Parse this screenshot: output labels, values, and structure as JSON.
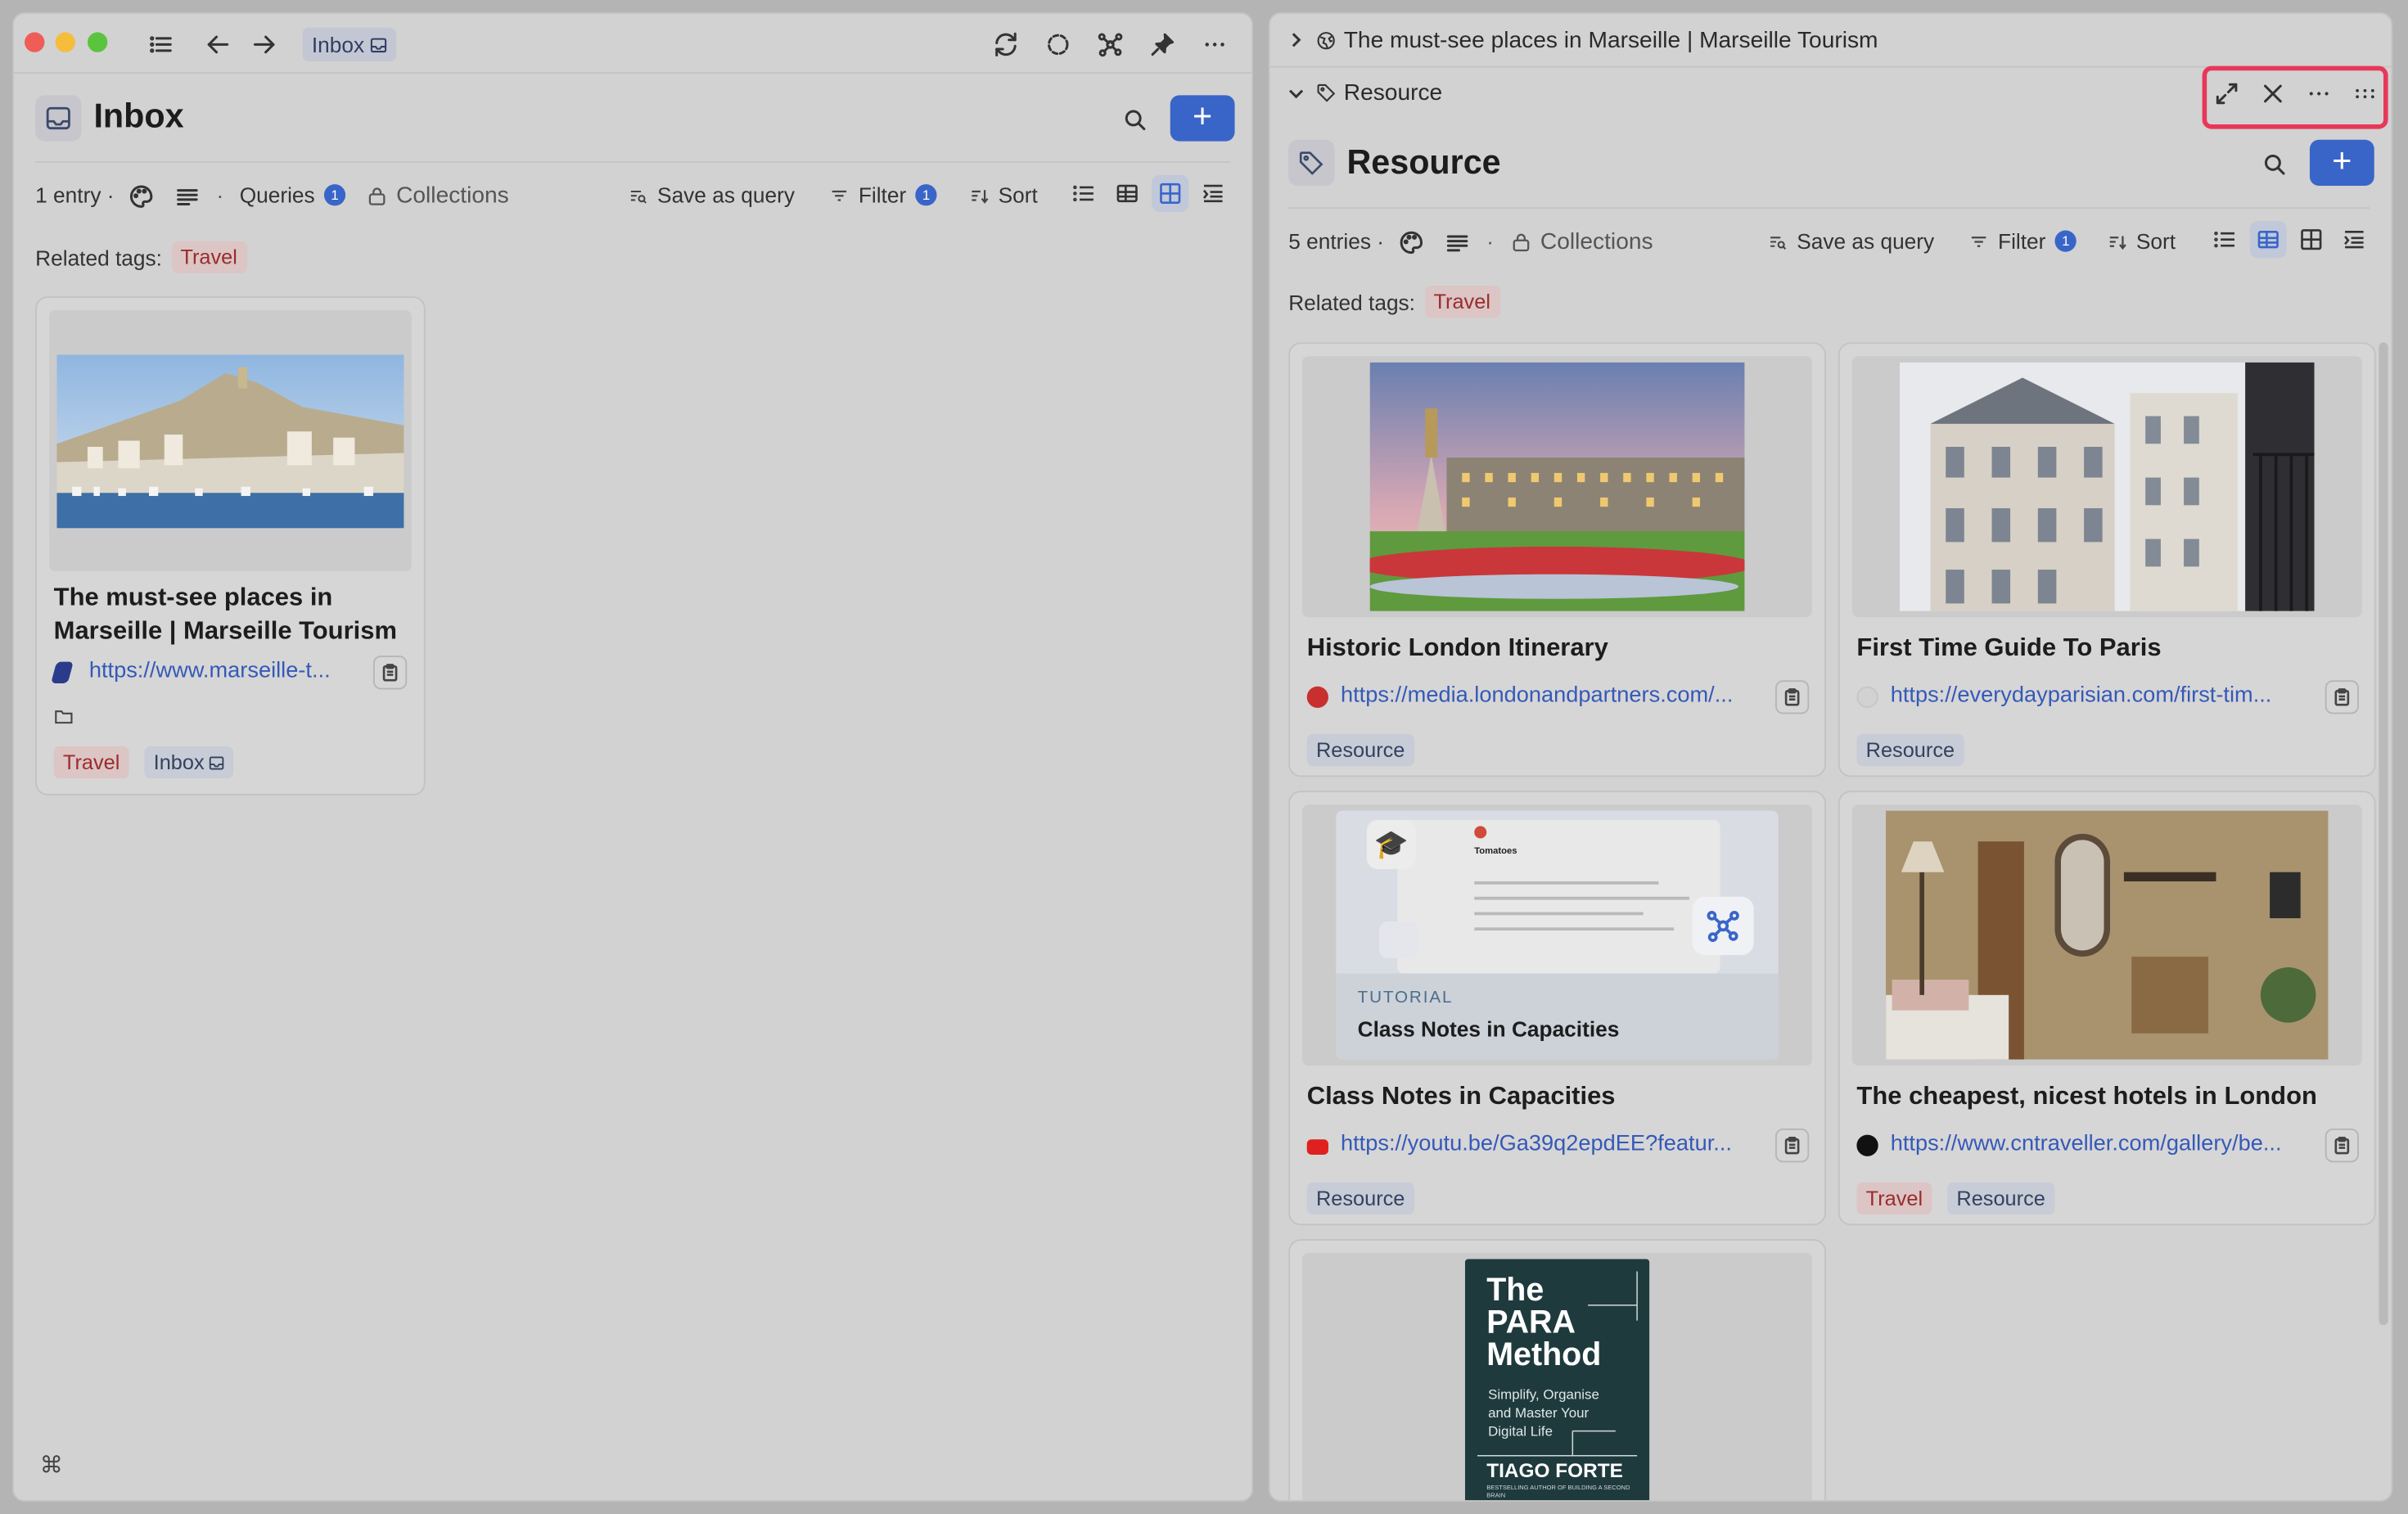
{
  "left": {
    "nav": {
      "breadcrumb_chip": "Inbox"
    },
    "page": {
      "title": "Inbox"
    },
    "toolbar": {
      "entry_count": "1 entry ·",
      "dot": "·",
      "queries_label": "Queries",
      "queries_count": "1",
      "collections_label": "Collections",
      "save_query_label": "Save as query",
      "filter_label": "Filter",
      "filter_count": "1",
      "sort_label": "Sort"
    },
    "related_tags_label": "Related tags:",
    "related_tags": [
      "Travel"
    ],
    "cards": [
      {
        "title": "The must-see places in Marseille | Marseille Tourism",
        "url": "https://www.marseille-t...",
        "tags": [
          "Travel",
          "Inbox"
        ]
      }
    ],
    "footer_shortcut": "⌘"
  },
  "right": {
    "breadcrumb_parent": "The must-see places in Marseille | Marseille Tourism",
    "breadcrumb_current": "Resource",
    "page": {
      "title": "Resource"
    },
    "toolbar": {
      "entry_count": "5 entries ·",
      "dot": "·",
      "collections_label": "Collections",
      "save_query_label": "Save as query",
      "filter_label": "Filter",
      "filter_count": "1",
      "sort_label": "Sort"
    },
    "related_tags_label": "Related tags:",
    "related_tags": [
      "Travel"
    ],
    "cards": [
      {
        "title": "Historic London Itinerary",
        "url": "https://media.londonandpartners.com/...",
        "tags": [
          "Resource"
        ]
      },
      {
        "title": "First Time Guide To Paris",
        "url": "https://everydayparisian.com/first-tim...",
        "tags": [
          "Resource"
        ]
      },
      {
        "title": "Class Notes in Capacities",
        "url": "https://youtu.be/Ga39q2epdEE?featur...",
        "tags": [
          "Resource"
        ],
        "thumb": {
          "eyebrow": "TUTORIAL",
          "heading": "Class Notes in Capacities",
          "doc_title": "Tomatoes"
        }
      },
      {
        "title": "The cheapest, nicest hotels in London",
        "url": "https://www.cntraveller.com/gallery/be...",
        "tags": [
          "Travel",
          "Resource"
        ]
      },
      {
        "title": "",
        "url": "",
        "tags": [],
        "book": {
          "line1": "The",
          "line2": "PARA",
          "line3": "Method",
          "subtitle": "Simplify, Organise and Master Your Digital Life",
          "author": "TIAGO FORTE",
          "author_note": "BESTSELLING AUTHOR OF BUILDING A SECOND BRAIN"
        }
      }
    ]
  },
  "colors": {
    "accent": "#3a65c8",
    "highlight": "#e8385a",
    "travel_tag": "#9a2c2c",
    "resource_tag": "#33425f"
  }
}
